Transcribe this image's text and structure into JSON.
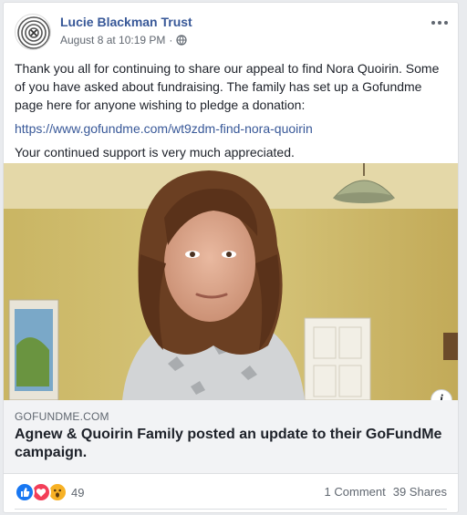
{
  "post": {
    "author": "Lucie Blackman Trust",
    "timestamp": "August 8 at 10:19 PM",
    "separator": "·",
    "audience_icon": "globe-icon",
    "more_icon": "more-options-icon",
    "paragraph1": "Thank you all for continuing to share our appeal to find Nora Quoirin. Some of you have asked about fundraising. The family has set up a Gofundme page here for anyone wishing to pledge a donation:",
    "link_text": "https://www.gofundme.com/wt9zdm-find-nora-quoirin",
    "paragraph2": "Your continued support is very much appreciated."
  },
  "link_preview": {
    "domain": "GOFUNDME.COM",
    "title": "Agnew & Quoirin Family posted an update to their GoFundMe campaign.",
    "info_label": "i"
  },
  "footer": {
    "reaction_icons": [
      "like-icon",
      "love-icon",
      "wow-icon"
    ],
    "reaction_count": "49",
    "comments": "1 Comment",
    "shares": "39 Shares"
  },
  "colors": {
    "link": "#385898",
    "text": "#1d2129",
    "meta": "#606770",
    "preview_bg": "#f2f3f5"
  }
}
